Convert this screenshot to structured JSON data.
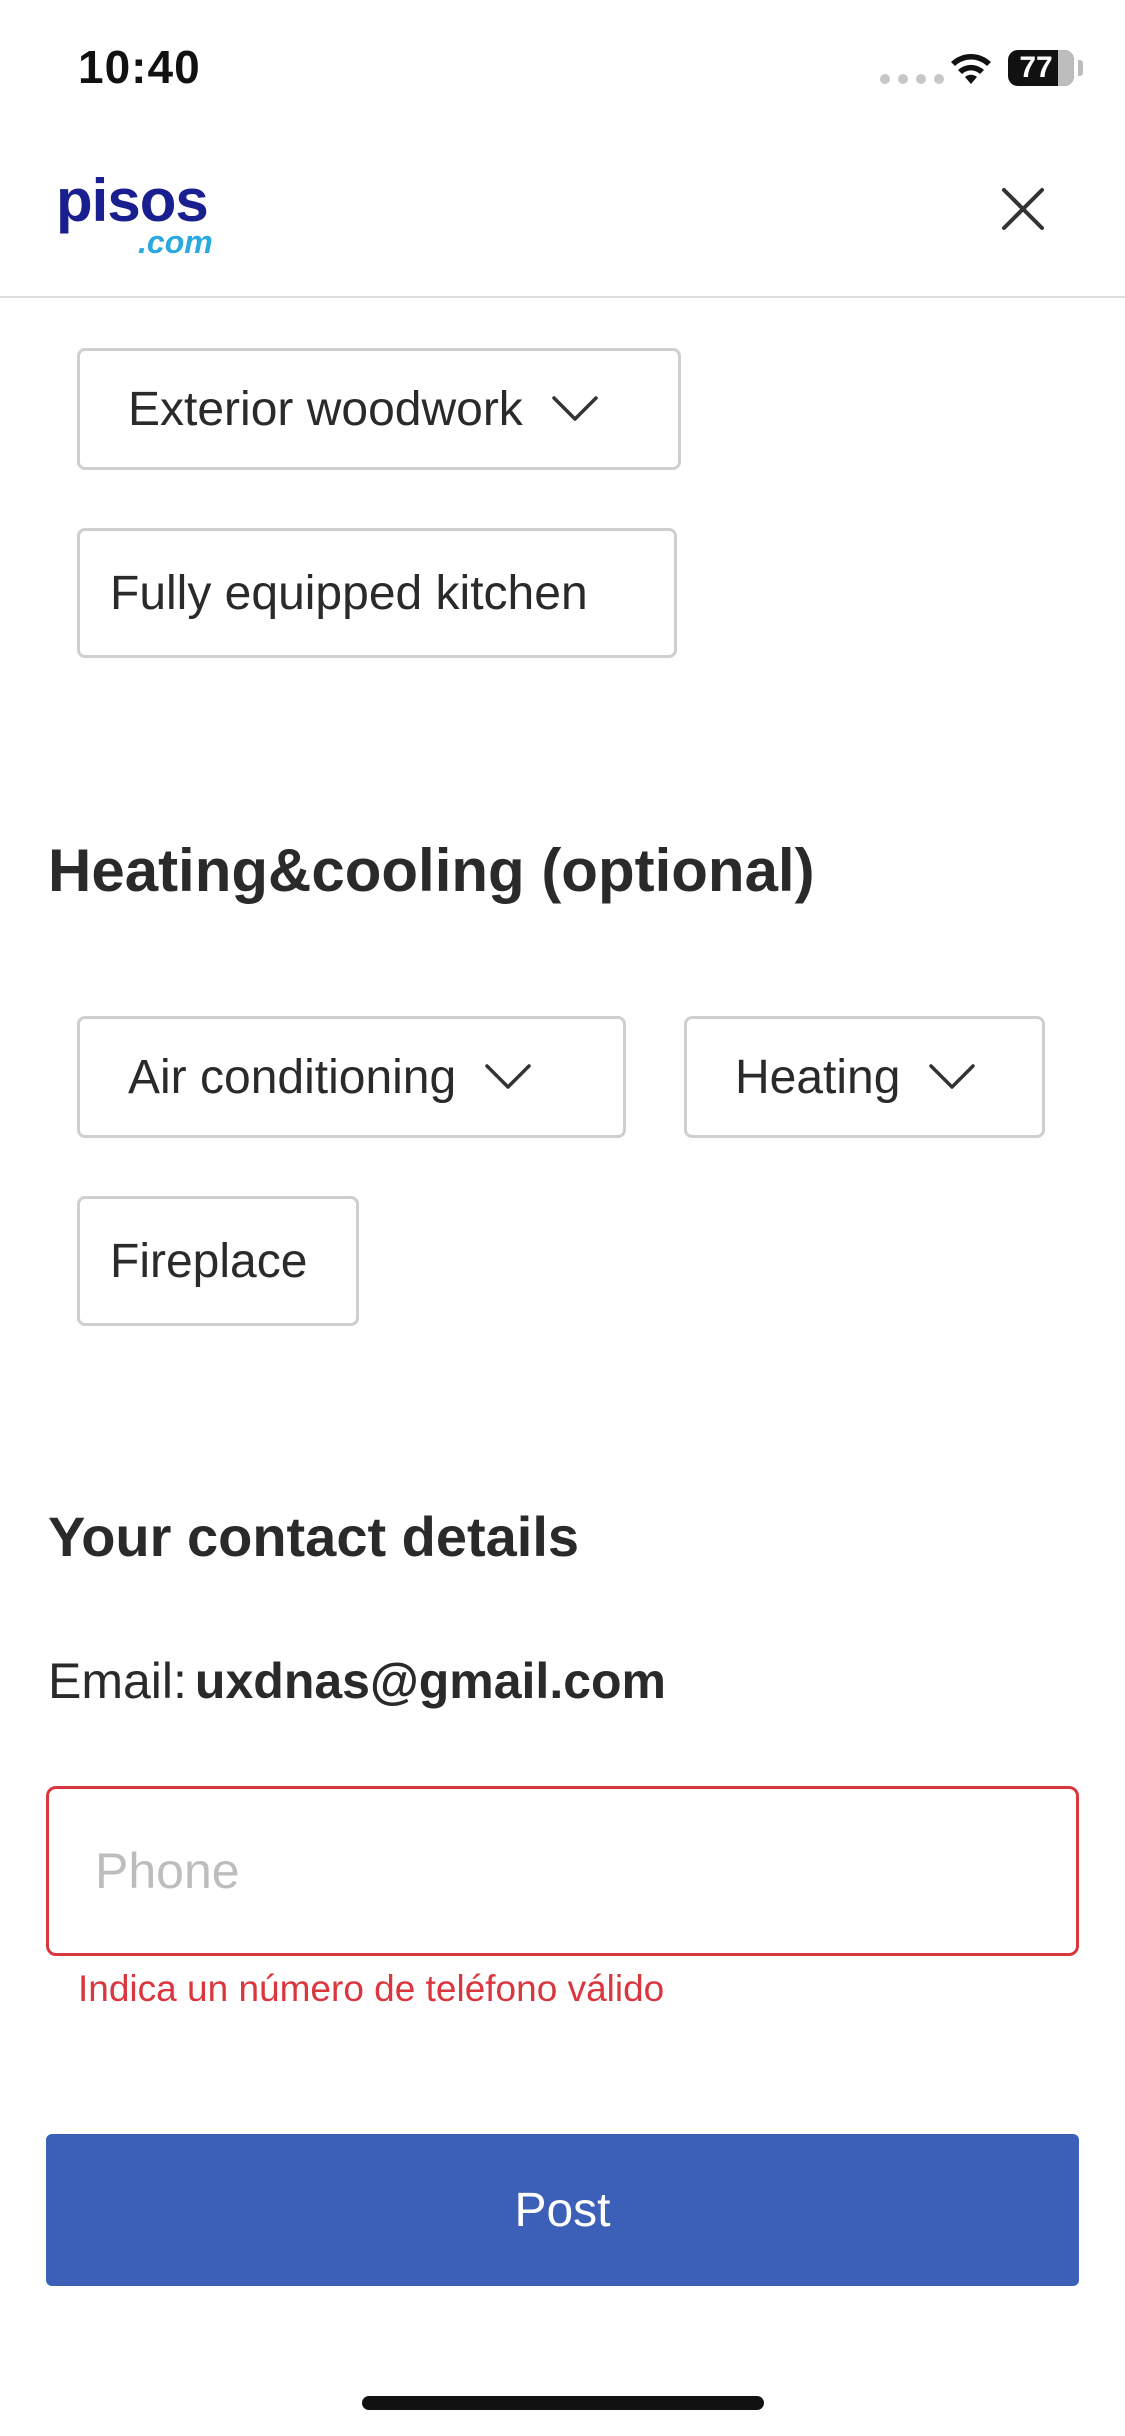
{
  "status_bar": {
    "time": "10:40",
    "battery": "77"
  },
  "header": {
    "logo_main": "pisos",
    "logo_sub": ".com",
    "close_icon": "close-icon"
  },
  "features": {
    "exterior_woodwork": "Exterior woodwork",
    "fully_equipped_kitchen": "Fully equipped kitchen"
  },
  "heating_cooling": {
    "title": "Heating&cooling (optional)",
    "air_conditioning": "Air conditioning",
    "heating": "Heating",
    "fireplace": "Fireplace"
  },
  "contact": {
    "title": "Your contact details",
    "email_label": "Email:",
    "email_value": "uxdnas@gmail.com",
    "phone_placeholder": "Phone",
    "phone_error": "Indica un número de teléfono válido"
  },
  "actions": {
    "post_label": "Post"
  },
  "colors": {
    "brand_blue": "#1a1f8f",
    "brand_light": "#2aa8e0",
    "primary_button": "#3c60b8",
    "error": "#d9363e"
  }
}
